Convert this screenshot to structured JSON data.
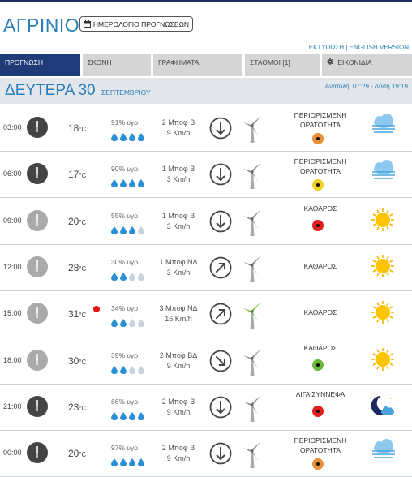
{
  "header": {
    "city": "ΑΓΡΙΝΙΟ",
    "calendar_button": "ΗΜΕΡΟΛΟΓΙΟ ΠΡΟΓΝΩΣΕΩΝ",
    "print_link": "ΕΚΤΥΠΩΣΗ | ENGLISH VERSION"
  },
  "tabs": [
    {
      "label": "ΠΡΟΓΝΩΣΗ",
      "active": true
    },
    {
      "label": "ΣΚΟΝΗ",
      "active": false
    },
    {
      "label": "ΓΡΑΦΗΜΑΤΑ",
      "active": false
    },
    {
      "label": "ΣΤΑΘΜΟΙ [1]",
      "active": false
    },
    {
      "label": "ΕΙΚΟΝΙΔΙΑ",
      "active": false,
      "icon": "gear-icon"
    }
  ],
  "day": {
    "title": "ΔΕΥΤΕΡΑ 30",
    "month": "ΣΕΠΤΕΜΒΡΙΟΥ",
    "sun": "Ανατολή: 07:29 - Δύση 19:19"
  },
  "colors": {
    "brand": "#2a7fb8",
    "tab_active": "#1f3b78",
    "tab_inactive": "#d5d5d5",
    "drop_full": "#2a8fd6",
    "drop_empty": "#c6d3de"
  },
  "rows": [
    {
      "time": "03:00",
      "night": true,
      "temp": "18",
      "unit": "°C",
      "hot": false,
      "humidity": "91% υγρ.",
      "drops": 4,
      "wind1": "2 Μποφ Β",
      "wind2": "9 Km/h",
      "dir": "S",
      "mill": "gray",
      "sky": [
        "ΠΕΡΙΟΡΙΣΜΕΝΗ",
        "ΟΡΑΤΟΤΗΤΑ"
      ],
      "dot": "#e8903a",
      "icon": "fog-icon"
    },
    {
      "time": "06:00",
      "night": true,
      "temp": "17",
      "unit": "°C",
      "hot": false,
      "humidity": "90% υγρ.",
      "drops": 4,
      "wind1": "1 Μποφ Β",
      "wind2": "3 Km/h",
      "dir": "S",
      "mill": "gray",
      "sky": [
        "ΠΕΡΙΟΡΙΣΜΕΝΗ",
        "ΟΡΑΤΟΤΗΤΑ"
      ],
      "dot": "#f0d020",
      "icon": "fog-icon"
    },
    {
      "time": "09:00",
      "night": false,
      "temp": "20",
      "unit": "°C",
      "hot": false,
      "humidity": "55% υγρ.",
      "drops": 3,
      "wind1": "1 Μποφ Β",
      "wind2": "3 Km/h",
      "dir": "S",
      "mill": "gray",
      "sky": [
        "ΚΑΘΑΡΟΣ"
      ],
      "dot": "#e02020",
      "icon": "sun-icon"
    },
    {
      "time": "12:00",
      "night": false,
      "temp": "28",
      "unit": "°C",
      "hot": false,
      "humidity": "30% υγρ.",
      "drops": 2,
      "wind1": "1 Μποφ ΝΔ",
      "wind2": "3 Km/h",
      "dir": "NE",
      "mill": "gray",
      "sky": [
        "ΚΑΘΑΡΟΣ"
      ],
      "dot": "",
      "icon": "sun-icon"
    },
    {
      "time": "15:00",
      "night": false,
      "temp": "31",
      "unit": "°C",
      "hot": true,
      "humidity": "34% υγρ.",
      "drops": 2,
      "wind1": "3 Μποφ ΝΔ",
      "wind2": "16 Km/h",
      "dir": "NE",
      "mill": "green",
      "sky": [
        "ΚΑΘΑΡΟΣ"
      ],
      "dot": "",
      "icon": "sun-icon"
    },
    {
      "time": "18:00",
      "night": false,
      "temp": "30",
      "unit": "°C",
      "hot": false,
      "humidity": "39% υγρ.",
      "drops": 2,
      "wind1": "2 Μποφ ΒΔ",
      "wind2": "9 Km/h",
      "dir": "SE",
      "mill": "gray",
      "sky": [
        "ΚΑΘΑΡΟΣ"
      ],
      "dot": "#6ab83a",
      "icon": "sun-icon"
    },
    {
      "time": "21:00",
      "night": true,
      "temp": "23",
      "unit": "°C",
      "hot": false,
      "humidity": "86% υγρ.",
      "drops": 4,
      "wind1": "2 Μποφ Β",
      "wind2": "9 Km/h",
      "dir": "S",
      "mill": "gray",
      "sky": [
        "ΛΙΓΑ ΣΥΝΝΕΦΑ"
      ],
      "dot": "#e02020",
      "icon": "moon-cloud-icon"
    },
    {
      "time": "00:00",
      "night": true,
      "temp": "20",
      "unit": "°C",
      "hot": false,
      "humidity": "97% υγρ.",
      "drops": 4,
      "wind1": "2 Μποφ Β",
      "wind2": "9 Km/h",
      "dir": "S",
      "mill": "gray",
      "sky": [
        "ΠΕΡΙΟΡΙΣΜΕΝΗ",
        "ΟΡΑΤΟΤΗΤΑ"
      ],
      "dot": "#e8903a",
      "icon": "fog-icon"
    }
  ]
}
